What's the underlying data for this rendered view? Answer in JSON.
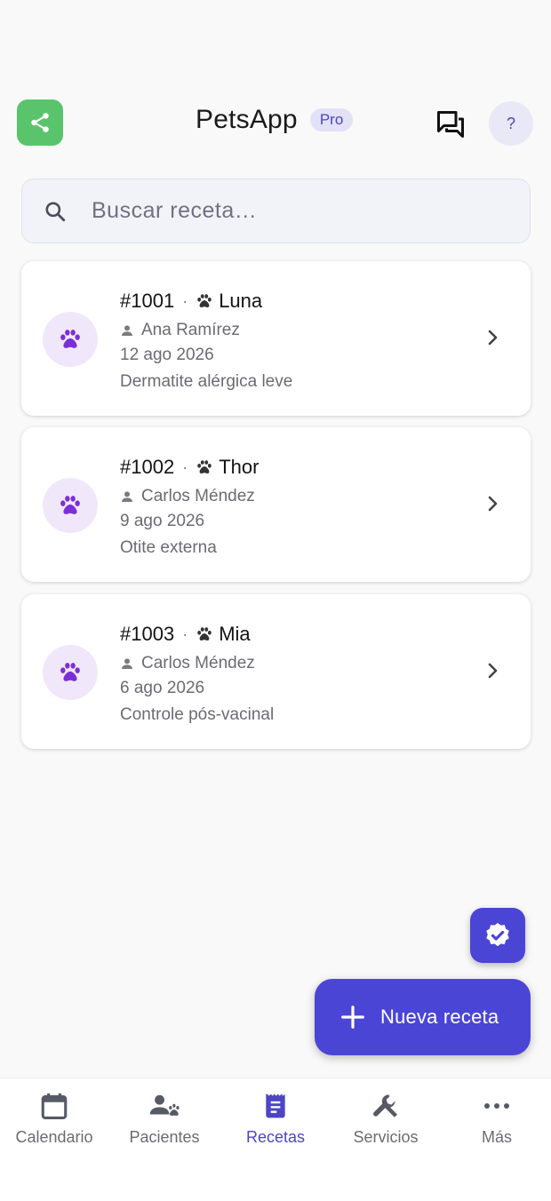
{
  "header": {
    "title": "PetsApp",
    "badge": "Pro",
    "help_label": "?",
    "icons": {
      "share": "share-icon",
      "chat": "forum-icon"
    }
  },
  "search": {
    "placeholder": "Buscar receta…",
    "value": ""
  },
  "prescriptions": [
    {
      "number": "#1001",
      "pet": "Luna",
      "owner": "Ana Ramírez",
      "date": "12 ago 2026",
      "note": "Dermatite alérgica leve"
    },
    {
      "number": "#1002",
      "pet": "Thor",
      "owner": "Carlos Méndez",
      "date": "9 ago 2026",
      "note": "Otite externa"
    },
    {
      "number": "#1003",
      "pet": "Mia",
      "owner": "Carlos Méndez",
      "date": "6 ago 2026",
      "note": "Controle pós-vacinal"
    }
  ],
  "fab": {
    "label": "Nueva receta",
    "secondary_icon": "verified-icon"
  },
  "nav": [
    {
      "label": "Calendario",
      "icon": "calendar-icon",
      "active": false
    },
    {
      "label": "Pacientes",
      "icon": "patients-icon",
      "active": false
    },
    {
      "label": "Recetas",
      "icon": "receipt-icon",
      "active": true
    },
    {
      "label": "Servicios",
      "icon": "wrench-icon",
      "active": false
    },
    {
      "label": "Más",
      "icon": "more-icon",
      "active": false
    }
  ],
  "colors": {
    "accent": "#4b45d6",
    "share": "#5ac46c",
    "paw": "#7a2fd6",
    "avatar_bg": "#f1e7fb"
  }
}
